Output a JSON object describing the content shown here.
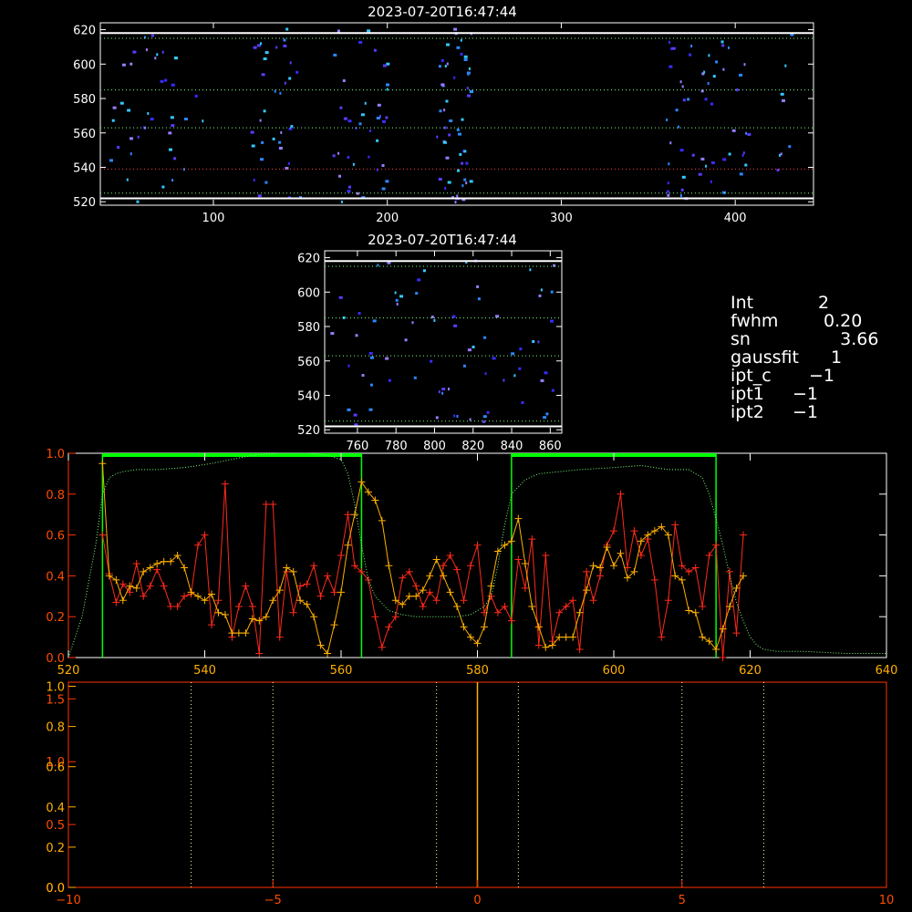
{
  "colors": {
    "background": "#000000",
    "axis_white": "#ffffff",
    "axis_red": "#ff3300",
    "orange": "#ffb000",
    "red_series": "#ff2a1a",
    "green": "#00ff00",
    "green_dotted": "#7dff7d",
    "dot_red": "#cc3333",
    "pixel_colors": [
      "#3a2cff",
      "#5a3cff",
      "#2a88ff",
      "#33c8ff",
      "#9a7cff"
    ]
  },
  "info_panel": [
    {
      "key": "Int",
      "value": "2"
    },
    {
      "key": "fwhm",
      "value": " 0.20"
    },
    {
      "key": "sn",
      "value": "    3.66"
    },
    {
      "key": "gaussfit",
      "value": "1"
    },
    {
      "key": "ipt_c",
      "value": "−1"
    },
    {
      "key": "ipt1",
      "value": "−1"
    },
    {
      "key": "ipt2",
      "value": "−1"
    }
  ],
  "chart_data": [
    {
      "id": "top_image",
      "type": "heatmap",
      "title": "2023-07-20T16:47:44",
      "xlim": [
        35,
        445
      ],
      "ylim": [
        518,
        624
      ],
      "x_ticks": [
        "100",
        "200",
        "300",
        "400"
      ],
      "x_tick_values": [
        100,
        200,
        300,
        400
      ],
      "y_ticks": [
        "520",
        "540",
        "560",
        "580",
        "600",
        "620"
      ],
      "y_tick_values": [
        520,
        540,
        560,
        580,
        600,
        620
      ],
      "hlines": [
        {
          "y": 618,
          "style": "solid",
          "color": "#ffffff"
        },
        {
          "y": 615,
          "style": "dotted",
          "color": "#7dff7d"
        },
        {
          "y": 585,
          "style": "dotted",
          "color": "#7dff7d"
        },
        {
          "y": 563,
          "style": "dotted",
          "color": "#7dff7d"
        },
        {
          "y": 539,
          "style": "dotted",
          "color": "#ff4040"
        },
        {
          "y": 525,
          "style": "dotted",
          "color": "#7dff7d"
        },
        {
          "y": 522,
          "style": "solid",
          "color": "#ffffff"
        }
      ],
      "pixel_clusters": [
        {
          "x0": 35,
          "x1": 95,
          "count": 40
        },
        {
          "x0": 120,
          "x1": 150,
          "count": 35
        },
        {
          "x0": 168,
          "x1": 200,
          "count": 40
        },
        {
          "x0": 228,
          "x1": 248,
          "count": 55
        },
        {
          "x0": 360,
          "x1": 408,
          "count": 55
        },
        {
          "x0": 418,
          "x1": 432,
          "count": 8
        }
      ]
    },
    {
      "id": "zoom_image",
      "type": "heatmap",
      "title": "2023-07-20T16:47:44",
      "xlim": [
        743,
        866
      ],
      "ylim": [
        518,
        624
      ],
      "x_ticks": [
        "760",
        "780",
        "800",
        "820",
        "840",
        "860"
      ],
      "x_tick_values": [
        760,
        780,
        800,
        820,
        840,
        860
      ],
      "y_ticks": [
        "520",
        "540",
        "560",
        "580",
        "600",
        "620"
      ],
      "y_tick_values": [
        520,
        540,
        560,
        580,
        600,
        620
      ],
      "hlines": [
        {
          "y": 618,
          "style": "solid",
          "color": "#ffffff"
        },
        {
          "y": 615,
          "style": "dotted",
          "color": "#7dff7d"
        },
        {
          "y": 585,
          "style": "dotted",
          "color": "#7dff7d"
        },
        {
          "y": 563,
          "style": "dotted",
          "color": "#7dff7d"
        },
        {
          "y": 525,
          "style": "dotted",
          "color": "#7dff7d"
        },
        {
          "y": 522,
          "style": "solid",
          "color": "#ffffff"
        }
      ],
      "pixel_clusters": [
        {
          "x0": 745,
          "x1": 865,
          "count": 75
        }
      ]
    },
    {
      "id": "profile",
      "type": "line",
      "xlim": [
        520,
        640
      ],
      "ylim": [
        0,
        1.0
      ],
      "x_ticks": [
        "520",
        "540",
        "560",
        "580",
        "600",
        "620",
        "640"
      ],
      "x_tick_values": [
        520,
        540,
        560,
        580,
        600,
        620,
        640
      ],
      "y_ticks": [
        "0.0",
        "0.2",
        "0.4",
        "0.6",
        "0.8",
        "1.0"
      ],
      "y_tick_values": [
        0,
        0.2,
        0.4,
        0.6,
        0.8,
        1.0
      ],
      "green_boxes": [
        [
          525,
          563
        ],
        [
          585,
          615
        ]
      ],
      "series": [
        {
          "color": "#ff2a1a",
          "marker": "+",
          "x": [
            525,
            526,
            527,
            528,
            529,
            530,
            531,
            532,
            533,
            534,
            535,
            536,
            537,
            538,
            539,
            540,
            541,
            542,
            543,
            544,
            545,
            546,
            547,
            548,
            549,
            550,
            551,
            552,
            553,
            554,
            555,
            556,
            557,
            558,
            559,
            560,
            561,
            562,
            563,
            564,
            565,
            566,
            567,
            568,
            569,
            570,
            571,
            572,
            573,
            574,
            575,
            576,
            577,
            578,
            579,
            580,
            581,
            582,
            583,
            584,
            585,
            586,
            587,
            588,
            589,
            590,
            591,
            592,
            593,
            594,
            595,
            596,
            597,
            598,
            599,
            600,
            601,
            602,
            603,
            604,
            605,
            606,
            607,
            608,
            609,
            610,
            611,
            612,
            613,
            614,
            615,
            616,
            617,
            618,
            619
          ],
          "values": [
            0.6,
            0.41,
            0.27,
            0.36,
            0.32,
            0.46,
            0.3,
            0.35,
            0.43,
            0.35,
            0.25,
            0.25,
            0.3,
            0.31,
            0.55,
            0.6,
            0.16,
            0.28,
            0.85,
            0.1,
            0.25,
            0.35,
            0.25,
            0.02,
            0.75,
            0.75,
            0.1,
            0.42,
            0.22,
            0.35,
            0.36,
            0.45,
            0.3,
            0.4,
            0.32,
            0.5,
            0.7,
            0.45,
            0.42,
            0.38,
            0.2,
            0.05,
            0.15,
            0.2,
            0.39,
            0.42,
            0.35,
            0.25,
            0.32,
            0.28,
            0.45,
            0.5,
            0.43,
            0.28,
            0.45,
            0.55,
            0.22,
            0.3,
            0.22,
            0.25,
            0.18,
            0.48,
            0.34,
            0.58,
            0.06,
            0.5,
            0.08,
            0.22,
            0.25,
            0.28,
            0.04,
            0.42,
            0.28,
            0.4,
            0.55,
            0.62,
            0.8,
            0.44,
            0.62,
            0.5,
            0.58,
            0.38,
            0.1,
            0.28,
            0.65,
            0.45,
            0.42,
            0.44,
            0.25,
            0.5,
            0.55,
            0.0,
            0.42,
            0.12,
            0.6
          ]
        },
        {
          "color": "#ffb000",
          "marker": "+",
          "x": [
            525,
            526,
            527,
            528,
            529,
            530,
            531,
            532,
            533,
            534,
            535,
            536,
            537,
            538,
            539,
            540,
            541,
            542,
            543,
            544,
            545,
            546,
            547,
            548,
            549,
            550,
            551,
            552,
            553,
            554,
            555,
            556,
            557,
            558,
            559,
            560,
            561,
            562,
            563,
            564,
            565,
            566,
            567,
            568,
            569,
            570,
            571,
            572,
            573,
            574,
            575,
            576,
            577,
            578,
            579,
            580,
            581,
            582,
            583,
            584,
            585,
            586,
            587,
            588,
            589,
            590,
            591,
            592,
            593,
            594,
            595,
            596,
            597,
            598,
            599,
            600,
            601,
            602,
            603,
            604,
            605,
            606,
            607,
            608,
            609,
            610,
            611,
            612,
            613,
            614,
            615,
            616,
            617,
            618,
            619
          ],
          "values": [
            0.95,
            0.4,
            0.38,
            0.28,
            0.35,
            0.34,
            0.42,
            0.44,
            0.46,
            0.47,
            0.47,
            0.5,
            0.44,
            0.32,
            0.3,
            0.28,
            0.31,
            0.22,
            0.21,
            0.12,
            0.12,
            0.12,
            0.19,
            0.18,
            0.2,
            0.28,
            0.33,
            0.44,
            0.42,
            0.28,
            0.26,
            0.2,
            0.06,
            0.02,
            0.16,
            0.32,
            0.55,
            0.7,
            0.86,
            0.81,
            0.77,
            0.67,
            0.45,
            0.28,
            0.26,
            0.3,
            0.3,
            0.33,
            0.4,
            0.48,
            0.4,
            0.32,
            0.25,
            0.15,
            0.1,
            0.07,
            0.15,
            0.35,
            0.52,
            0.55,
            0.57,
            0.68,
            0.46,
            0.25,
            0.15,
            0.05,
            0.06,
            0.1,
            0.1,
            0.1,
            0.22,
            0.33,
            0.45,
            0.44,
            0.54,
            0.45,
            0.51,
            0.39,
            0.42,
            0.57,
            0.6,
            0.62,
            0.64,
            0.6,
            0.4,
            0.38,
            0.23,
            0.22,
            0.1,
            0.08,
            0.04,
            0.14,
            0.25,
            0.34,
            0.4
          ]
        },
        {
          "color": "#7dff7d",
          "style": "dotted",
          "x": [
            520,
            522,
            524,
            525,
            526,
            527,
            528,
            530,
            533,
            537,
            541,
            544,
            547,
            551,
            555,
            558,
            560,
            561,
            562,
            563,
            564,
            565,
            567,
            569,
            571,
            574,
            577,
            579,
            581,
            582,
            583,
            584,
            585,
            587,
            589,
            592,
            595,
            600,
            604,
            608,
            611,
            613,
            614,
            615,
            616,
            617,
            618,
            619,
            620,
            621,
            622,
            624,
            628,
            634,
            640
          ],
          "values": [
            0.0,
            0.2,
            0.55,
            0.8,
            0.88,
            0.9,
            0.91,
            0.92,
            0.92,
            0.93,
            0.95,
            0.97,
            0.99,
            1.0,
            1.0,
            0.99,
            0.97,
            0.9,
            0.75,
            0.55,
            0.38,
            0.3,
            0.23,
            0.21,
            0.2,
            0.2,
            0.2,
            0.21,
            0.25,
            0.3,
            0.45,
            0.65,
            0.8,
            0.87,
            0.9,
            0.91,
            0.92,
            0.93,
            0.94,
            0.92,
            0.92,
            0.88,
            0.8,
            0.68,
            0.55,
            0.4,
            0.27,
            0.18,
            0.1,
            0.06,
            0.04,
            0.03,
            0.03,
            0.02,
            0.02
          ]
        }
      ]
    },
    {
      "id": "bottom",
      "type": "line",
      "xlim": [
        -10,
        10
      ],
      "ylim": [
        0,
        1.0
      ],
      "x_ticks": [
        "−10",
        "−5",
        "0",
        "5",
        "10"
      ],
      "x_tick_values": [
        -10,
        -5,
        0,
        5,
        10
      ],
      "y_ticks_left_red": [
        "0.0",
        "0.5",
        "1.0",
        "1.5"
      ],
      "y_tick_values_left_red": [
        0,
        0.5,
        1.0,
        1.5
      ],
      "y_ticks_left_orange": [
        "0.0",
        "0.2",
        "0.4",
        "0.6",
        "0.8",
        "1.0"
      ],
      "y_tick_values_left_orange": [
        0,
        0.2,
        0.4,
        0.6,
        0.8,
        1.0
      ],
      "vlines_dotted": [
        -7,
        -5,
        -1,
        1,
        5,
        7
      ],
      "vline_solid": 0
    }
  ]
}
